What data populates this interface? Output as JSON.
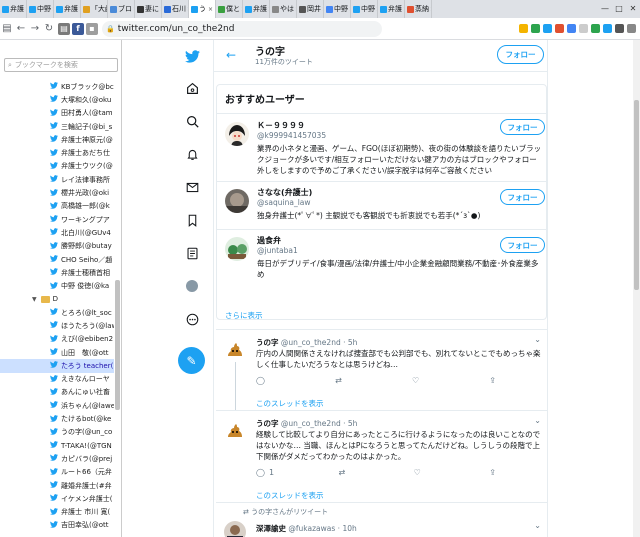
{
  "tabs": [
    {
      "label": "弁護",
      "color": "#1da1f2"
    },
    {
      "label": "中野",
      "color": "#1da1f2"
    },
    {
      "label": "弁護",
      "color": "#1da1f2"
    },
    {
      "label": "「大鹸",
      "color": "#e0a020"
    },
    {
      "label": "ブロ",
      "color": "#4a8ad8"
    },
    {
      "label": "妻に",
      "color": "#333333"
    },
    {
      "label": "石川",
      "color": "#2a6ad8"
    },
    {
      "label": "う",
      "color": "#1da1f2",
      "active": true
    },
    {
      "label": "僕と",
      "color": "#3aa040"
    },
    {
      "label": "弁護",
      "color": "#1da1f2"
    },
    {
      "label": "やは",
      "color": "#888888"
    },
    {
      "label": "岡井",
      "color": "#555555"
    },
    {
      "label": "中野",
      "color": "#4285f4"
    },
    {
      "label": "中野",
      "color": "#1da1f2"
    },
    {
      "label": "弁護",
      "color": "#1da1f2"
    },
    {
      "label": "蒸納",
      "color": "#e05030"
    }
  ],
  "window_controls": [
    "—",
    "□",
    "✕"
  ],
  "toolbar": {
    "url": "twitter.com/un_co_the2nd"
  },
  "sidebar": {
    "search_placeholder": "ブックマークを検索",
    "items": [
      {
        "label": "KBブラック@bcr",
        "type": "bird"
      },
      {
        "label": "大塚和久(@oku",
        "type": "bird"
      },
      {
        "label": "田村勇人(@tam",
        "type": "bird"
      },
      {
        "label": "三輪記子(@bi_s",
        "type": "bird"
      },
      {
        "label": "弁護士神原元(@",
        "type": "bird"
      },
      {
        "label": "弁護士あだち仕",
        "type": "bird"
      },
      {
        "label": "弁護士ウツク(@",
        "type": "bird"
      },
      {
        "label": "レイ法律事務所",
        "type": "bird"
      },
      {
        "label": "櫻井光政(@oki",
        "type": "bird"
      },
      {
        "label": "高橋雄一郎(@k",
        "type": "bird"
      },
      {
        "label": "ワーキングプア",
        "type": "bird"
      },
      {
        "label": "北白川(@GUv4",
        "type": "bird"
      },
      {
        "label": "勝野郎(@butay",
        "type": "bird"
      },
      {
        "label": "CHO Seiho／趙",
        "type": "bird"
      },
      {
        "label": "弁護士穂積首相",
        "type": "bird"
      },
      {
        "label": "中野 俊徳(@ka",
        "type": "bird"
      },
      {
        "label": "D",
        "type": "folder"
      },
      {
        "label": "とろろ(@lt_soc",
        "type": "bird"
      },
      {
        "label": "ほうたろう(@law",
        "type": "bird"
      },
      {
        "label": "えび(@ebiben2",
        "type": "bird"
      },
      {
        "label": "山田　敬(@ott",
        "type": "bird"
      },
      {
        "label": "たろう teacher(",
        "type": "bird",
        "selected": true
      },
      {
        "label": "えきなんローヤ",
        "type": "bird"
      },
      {
        "label": "あんにゅい社畜",
        "type": "bird"
      },
      {
        "label": "浜ちゃん(@lawe",
        "type": "bird"
      },
      {
        "label": "たけるbot(@ke",
        "type": "bird"
      },
      {
        "label": "うの字(@un_co",
        "type": "bird"
      },
      {
        "label": "T-TAKA!(@TGN",
        "type": "bird"
      },
      {
        "label": "カピバラ(@prej",
        "type": "bird"
      },
      {
        "label": "ルート66（元弁",
        "type": "bird"
      },
      {
        "label": "離婚弁護士(#弁",
        "type": "bird"
      },
      {
        "label": "イケメン弁護士(",
        "type": "bird"
      },
      {
        "label": "弁護士 市川 寛(",
        "type": "bird"
      },
      {
        "label": "吉田幸弘(@ott",
        "type": "bird"
      }
    ]
  },
  "nav_icons": [
    "twitter-logo-icon",
    "home-icon",
    "explore-icon",
    "notifications-icon",
    "messages-icon",
    "bookmarks-icon",
    "lists-icon",
    "profile-icon",
    "more-icon"
  ],
  "profile_header": {
    "name": "うの字",
    "tweet_count": "11万件のツイート",
    "follow_label": "フォロー"
  },
  "recommendations": {
    "title": "おすすめユーザー",
    "more_label": "さらに表示",
    "users": [
      {
        "name": "Ｋ－９９９９",
        "handle": "@k999941457035",
        "bio": "業界の小ネタと漫画、ゲーム、FGO(ほぼ初期勢)、夜の街の体験談を語りたいブラックジョークが多いです/相互フォローいただけない鍵アカの方はブロックやフォロー外しをしますので予めご了承ください/誤字脱字は何卒ご容赦ください",
        "follow_label": "フォロー"
      },
      {
        "name": "さなな(弁護士)",
        "handle": "@saquina_law",
        "bio": "独身弁護士(*ﾟ∀ﾟ*) 主観説でも客観説でも折衷説でも若手(*´з`●)",
        "follow_label": "フォロー"
      },
      {
        "name": "過食弁",
        "handle": "@juntaba1",
        "bio": "毎日がデブリデイ/食事/漫画/法律/弁護士/中小企業金融顧問業務/不動産･外食産業多め",
        "follow_label": "フォロー"
      }
    ]
  },
  "tweets": [
    {
      "name": "うの字",
      "handle": "@un_co_the2nd",
      "time": "5h",
      "text": "庁内の人間関係さえなければ捜査部でも公判部でも、別れてないとこでもめっちゃ楽しく仕事したいだろうなとは思うけどね…",
      "reply_count": "",
      "retweet_count": "",
      "like_count": "",
      "thread_label": "このスレッドを表示"
    },
    {
      "name": "うの字",
      "handle": "@un_co_the2nd",
      "time": "5h",
      "text": "経験して比較してより自分にあったところに行けるようになったのは良いことなのではないかな… 当職、ほんとはPになろうと思ってたんだけどね。しうしうの段階で上下関係がダメだってわかったのはよかった。",
      "reply_count": "1",
      "retweet_count": "",
      "like_count": "",
      "thread_label": "このスレッドを表示"
    },
    {
      "retweet_note": "うの字さんがリツイート",
      "name": "深澤諭史",
      "handle": "@fukazawas",
      "time": "10h",
      "text": "",
      "reply_count": "",
      "retweet_count": "",
      "like_count": ""
    }
  ],
  "colors": {
    "twitter_blue": "#1da1f2",
    "text_secondary": "#657786"
  }
}
